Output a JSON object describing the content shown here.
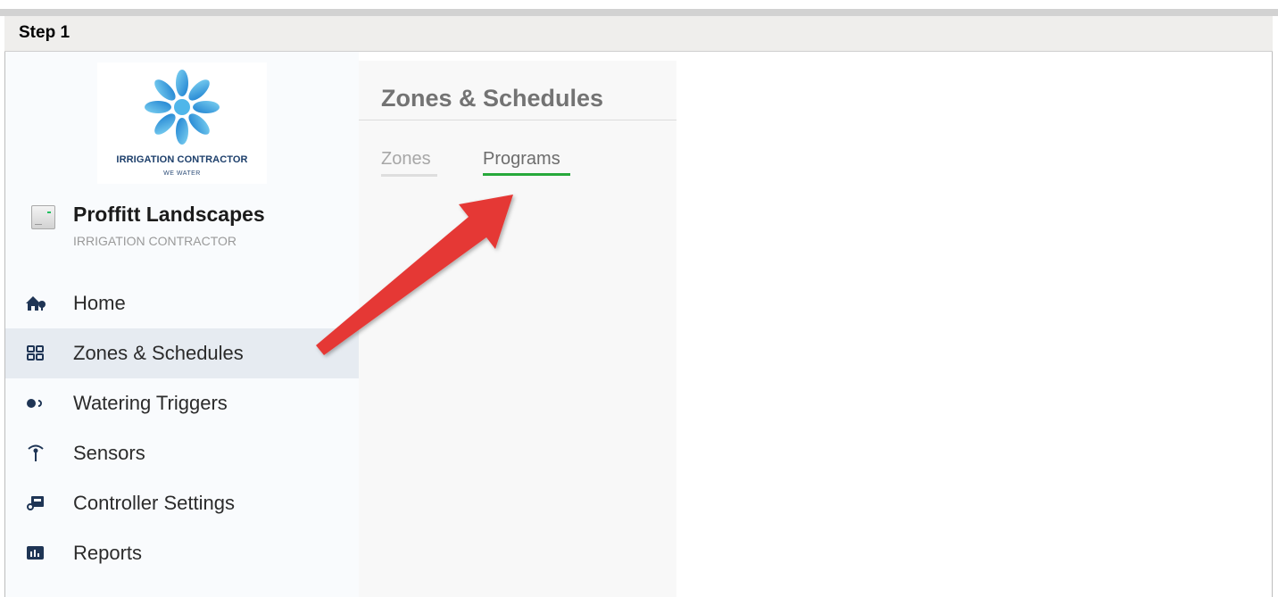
{
  "step": {
    "label": "Step 1"
  },
  "logo": {
    "title": "IRRIGATION CONTRACTOR",
    "subtitle": "WE WATER"
  },
  "account": {
    "name": "Proffitt Landscapes",
    "type": "IRRIGATION CONTRACTOR",
    "icon": "controller-device-icon"
  },
  "sidebar": {
    "items": [
      {
        "label": "Home",
        "icon": "home-icon",
        "active": false
      },
      {
        "label": "Zones & Schedules",
        "icon": "zones-grid-icon",
        "active": true
      },
      {
        "label": "Watering Triggers",
        "icon": "trigger-toggle-icon",
        "active": false
      },
      {
        "label": "Sensors",
        "icon": "antenna-icon",
        "active": false
      },
      {
        "label": "Controller Settings",
        "icon": "controller-settings-icon",
        "active": false
      },
      {
        "label": "Reports",
        "icon": "bar-chart-icon",
        "active": false
      }
    ]
  },
  "panel": {
    "title": "Zones & Schedules",
    "tabs": [
      {
        "label": "Zones",
        "active": false
      },
      {
        "label": "Programs",
        "active": true
      }
    ]
  },
  "colors": {
    "active_tab_underline": "#27a93b",
    "annotation_arrow": "#e53935",
    "active_nav_bg": "#e6ebf1"
  }
}
